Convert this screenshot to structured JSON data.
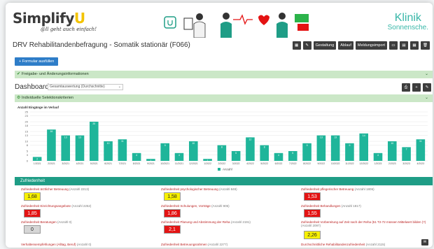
{
  "header": {
    "logo_main": "Simplify",
    "logo_accent": "U",
    "slogan": "@ll geht auch einfach!",
    "clinic_line1": "Klinik",
    "clinic_line2": "Sonnensche."
  },
  "titlebar": {
    "title": "DRV Rehabilitandenbefragung - Somatik stationär (F066)",
    "buttons": [
      "▦",
      "✎",
      "Gestaltung",
      "Ablauf",
      "Meldungsimport",
      "▭",
      "▤",
      "▦",
      "🗑"
    ]
  },
  "form_button": "+ Formular ausfüllen",
  "release_bar": "Freigabe- und Änderungsinformationen",
  "dashboards": {
    "label": "Dashboards",
    "select_value": "Gesamtauswertung (Durchschnitte)"
  },
  "selection_bar": "Individuelle Selektionskriterien",
  "chart_data": {
    "type": "bar",
    "title": "Anzahl Eingänge im Verlauf",
    "legend": "Anzahl",
    "color": "#1fb59a",
    "ylim": [
      0,
      25
    ],
    "yticks": [
      0,
      3,
      5,
      8,
      10,
      13,
      15,
      18,
      20,
      23,
      25
    ],
    "categories": [
      "1/2021",
      "2/2021",
      "3/2021",
      "4/2021",
      "5/2021",
      "6/2021",
      "7/2021",
      "8/2021",
      "9/2021",
      "10/2021",
      "11/2021",
      "12/2021",
      "1/2022",
      "2/2022",
      "3/2022",
      "4/2022",
      "5/2022",
      "6/2022",
      "7/2022",
      "8/2022",
      "9/2022",
      "10/2022",
      "11/2022",
      "12/2022",
      "1/2023",
      "2/2023",
      "3/2023",
      "4/2023"
    ],
    "values": [
      2,
      16,
      13,
      13,
      20,
      10,
      11,
      4,
      1,
      9,
      4,
      10,
      1,
      8,
      5,
      12,
      8,
      4,
      5,
      9,
      13,
      13,
      9,
      14,
      4,
      10,
      7,
      11
    ],
    "bar_labels": [
      "2",
      "16",
      "13",
      "13",
      "20",
      "10",
      "11",
      "4",
      "1",
      "9",
      "4",
      "10",
      "1",
      "8",
      "5",
      "12",
      "8",
      "4",
      "5",
      "9",
      "13",
      "13",
      "9",
      "14",
      "4",
      "10",
      "7",
      "11"
    ]
  },
  "satisfaction": {
    "heading": "Zufriedenheit",
    "metrics": [
      {
        "label": "Zufriedenheit ärztlicher Betreuung",
        "count": "(Anzahl 2213)",
        "value": "1,68",
        "color": "yellow"
      },
      {
        "label": "Zufriedenheit psychologischer Betreuung",
        "count": "(Anzahl 849)",
        "value": "1,58",
        "color": "yellow"
      },
      {
        "label": "Zufriedenheit pflegerischer Betreuung",
        "count": "(Anzahl 1806)",
        "value": "1,53",
        "color": "red"
      },
      {
        "label": "Zufriedenheit Einrichtungsangebote",
        "count": "(Anzahl 2252)",
        "value": "1,85",
        "color": "red"
      },
      {
        "label": "Zufriedenheit Schulungen, Vorträge",
        "count": "(Anzahl 905)",
        "value": "1,86",
        "color": "red"
      },
      {
        "label": "Zufriedenheit Behandlungen",
        "count": "(Anzahl 1817)",
        "value": "1,55",
        "color": "red"
      },
      {
        "label": "Zufriedenheit Beratungen",
        "count": "(Anzahl 0)",
        "value": "0",
        "color": "grey"
      },
      {
        "label": "Zufriedenheit Planung und Abstimmung der Reha",
        "count": "(Anzahl 2191)",
        "value": "2,1",
        "color": "red"
      },
      {
        "label": "Zufriedenheit Vorbereitung auf Zeit nach der Reha (51 T2-72 müssen Mittelwert bilden (?)",
        "count": "(Anzahl 2097)",
        "value": "2,26",
        "color": "yellow"
      },
      {
        "label": "Verhaltensempfehlungen (Alltag, Beruf)",
        "count": "(Anzahl 0)",
        "value": "",
        "color": "none"
      },
      {
        "label": "Zufriedenheit Betreuungsrahmen",
        "count": "(Anzahl 2277)",
        "value": "",
        "color": "none"
      },
      {
        "label": "Durchschnittliche Rehabilitandenzufriedenheit",
        "count": "(Anzahl 2115)",
        "value": "",
        "color": "none"
      }
    ]
  }
}
